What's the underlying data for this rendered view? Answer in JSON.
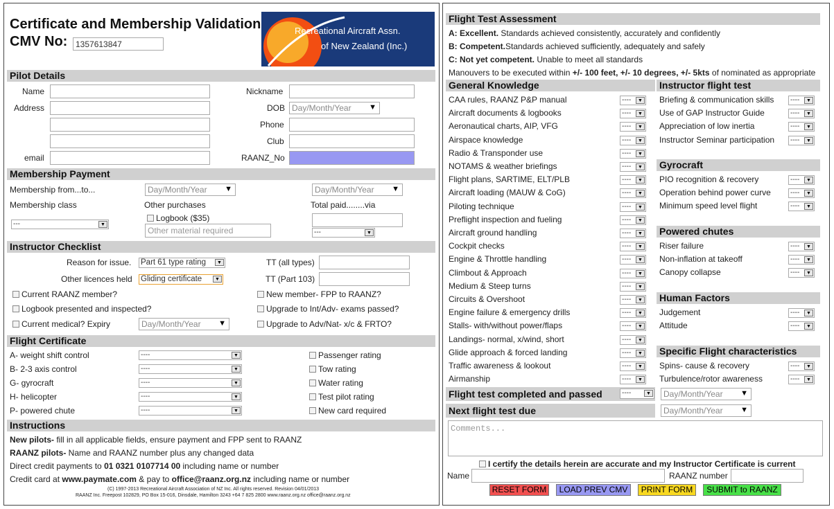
{
  "header": {
    "title": "Certificate and Membership Validation",
    "cmv_label": "CMV No:",
    "cmv_value": "1357613847",
    "logo_line1": "Recreational Aircraft Assn.",
    "logo_line2": "of New Zealand (Inc.)"
  },
  "pilot": {
    "heading": "Pilot Details",
    "name": "Name",
    "nickname": "Nickname",
    "address": "Address",
    "dob": "DOB",
    "dob_ph": "Day/Month/Year",
    "phone": "Phone",
    "club": "Club",
    "email": "email",
    "raanz": "RAANZ_No"
  },
  "membership": {
    "heading": "Membership Payment",
    "from_to": "Membership from...to...",
    "date_ph": "Day/Month/Year",
    "class": "Membership class",
    "class_val": "---",
    "other": "Other purchases",
    "logbook": "Logbook ($35)",
    "other_ph": "Other material required",
    "total": "Total paid........via",
    "via_val": "---"
  },
  "checklist": {
    "heading": "Instructor Checklist",
    "reason": "Reason for issue.",
    "reason_val": "Part 61 type rating",
    "licences": "Other licences held",
    "licences_val": "Gliding certificate",
    "tt_all": "TT (all types)",
    "tt_103": "TT (Part 103)",
    "c1": "Current RAANZ member?",
    "c2": "Logbook presented and inspected?",
    "c3": "Current medical? Expiry",
    "expiry_ph": "Day/Month/Year",
    "c4": "New member- FPP to RAANZ?",
    "c5": "Upgrade to Int/Adv- exams passed?",
    "c6": "Upgrade to Adv/Nat- x/c & FRTO?"
  },
  "certificate": {
    "heading": "Flight Certificate",
    "dash": "----",
    "rows": [
      "A- weight shift control",
      "B- 2-3 axis control",
      "G- gyrocraft",
      "H- helicopter",
      "P- powered chute"
    ],
    "ratings": [
      "Passenger rating",
      "Tow rating",
      "Water rating",
      "Test pilot rating",
      "New card required"
    ]
  },
  "instructions": {
    "heading": "Instructions",
    "l1b": "New pilots-",
    "l1": " fill in all applicable fields, ensure payment and FPP sent to RAANZ",
    "l2b": "RAANZ pilots-",
    "l2": " Name and RAANZ number plus any changed data",
    "l3a": "Direct credit payments to ",
    "l3b": "01 0321 0107714 00",
    "l3c": " including name or number",
    "l4a": "Credit card at ",
    "l4b": "www.paymate.com",
    "l4c": " & pay to ",
    "l4d": "office@raanz.org.nz",
    "l4e": " including name or number",
    "f1": "(C) 1997-2013 Recreational Aircraft Association of NZ Inc. All rights reserved. Revision 04/01/2013",
    "f2": "RAANZ Inc. Freepost 102829, PO Box 15-016, Dinsdale, Hamilton 3243 +64 7 825 2800 www.raanz.org.nz office@raanz.org.nz"
  },
  "assessment": {
    "heading": "Flight Test Assessment",
    "a_b": "A: Excellent.",
    "a": " Standards achieved consistently, accurately and confidently",
    "b_b": "B: Competent.",
    "b": "Standards achieved sufficiently, adequately and safely",
    "c_b": "C: Not yet competent.",
    "c": " Unable to meet all standards",
    "m1": "Manouvers to be executed within ",
    "m2": "+/- 100 feet, +/- 10 degrees, +/- 5kts",
    "m3": " of nominated as appropriate"
  },
  "gk": {
    "heading": "General Knowledge",
    "dash": "----",
    "items": [
      "CAA rules, RAANZ P&P manual",
      "Aircraft documents & logbooks",
      "Aeronautical charts, AIP, VFG",
      "Airspace knowledge",
      "Radio & Transponder use",
      "NOTAMS & weather briefings",
      "Flight plans, SARTIME, ELT/PLB",
      "Aircraft loading (MAUW & CoG)",
      "Piloting technique",
      "Preflight inspection and fueling",
      "Aircraft ground handling",
      "Cockpit checks",
      "Engine & Throttle handling",
      "Climbout & Approach",
      "Medium & Steep turns",
      "Circuits & Overshoot",
      "Engine failure & emergency drills",
      "Stalls- with/without power/flaps",
      "Landings- normal, x/wind, short",
      "Glide approach & forced landing",
      "Traffic awareness & lookout",
      "Airmanship"
    ]
  },
  "ift": {
    "heading": "Instructor flight test",
    "items": [
      "Briefing & communication skills",
      "Use of GAP Instructor Guide",
      "Appreciation of low inertia",
      "Instructor Seminar participation"
    ]
  },
  "gyro": {
    "heading": "Gyrocraft",
    "items": [
      "PIO recognition & recovery",
      "Operation behind power curve",
      "Minimum speed level flight"
    ]
  },
  "chutes": {
    "heading": "Powered chutes",
    "items": [
      "Riser failure",
      "Non-inflation at takeoff",
      "Canopy collapse"
    ]
  },
  "hf": {
    "heading": "Human Factors",
    "items": [
      "Judgement",
      "Attitude"
    ]
  },
  "sfc": {
    "heading": "Specific Flight characteristics",
    "items": [
      "Spins- cause & recovery",
      "Turbulence/rotor awareness"
    ]
  },
  "result": {
    "passed": "Flight test completed and passed",
    "next": "Next flight test due",
    "date_ph": "Day/Month/Year",
    "comments_ph": "Comments...",
    "certify": "I certify the details herein are accurate and my Instructor Certificate is current",
    "name": "Name",
    "raanz_number": "RAANZ number"
  },
  "buttons": {
    "reset": "RESET FORM",
    "load": "LOAD PREV CMV",
    "print": "PRINT FORM",
    "submit": "SUBMIT to RAANZ"
  }
}
